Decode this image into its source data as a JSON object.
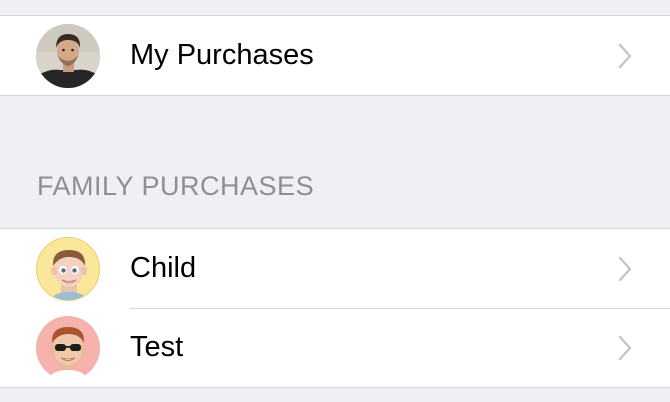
{
  "my_purchases": {
    "label": "My Purchases",
    "avatar_icon": "user-photo"
  },
  "family_section": {
    "header": "FAMILY PURCHASES",
    "members": [
      {
        "label": "Child",
        "avatar_icon": "memoji-child",
        "avatar_bg": "#fbe79a"
      },
      {
        "label": "Test",
        "avatar_icon": "memoji-sunglasses",
        "avatar_bg": "#f6b2ad"
      }
    ]
  },
  "colors": {
    "background": "#efeff4",
    "section_header": "#8e8e93",
    "chevron": "#c4c4c9"
  }
}
